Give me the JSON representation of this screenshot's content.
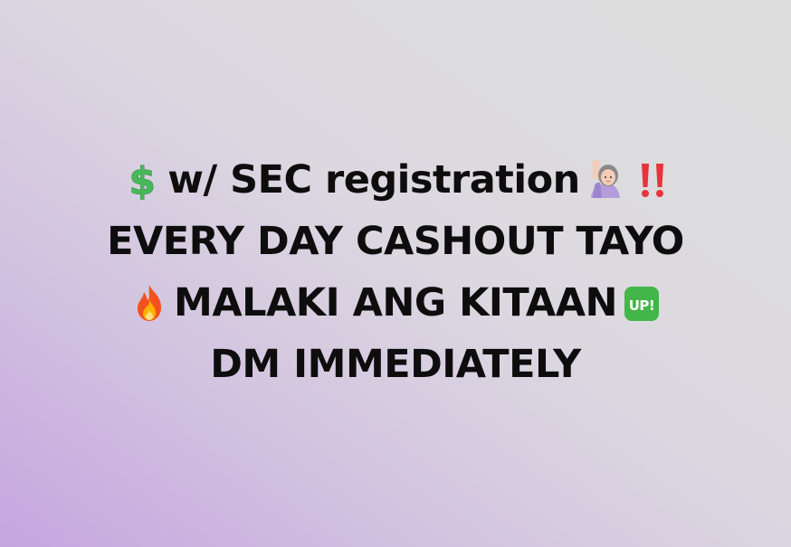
{
  "post": {
    "lines": [
      {
        "before_icon": "money-with-dollar",
        "text": "w/ SEC registration",
        "after_icons": [
          "woman-raising-hand",
          "double-exclamation"
        ]
      },
      {
        "text": "EVERY DAY CASHOUT TAYO"
      },
      {
        "before_icon": "fire",
        "text": "MALAKI ANG KITAAN",
        "after_icons": [
          "up-button"
        ]
      },
      {
        "text": "DM IMMEDIATELY"
      }
    ],
    "up_badge_text": "UP!",
    "colors": {
      "text": "#0d0d0d",
      "gradient_start": "#c5a6e0",
      "gradient_end": "#dcdcdc"
    }
  }
}
